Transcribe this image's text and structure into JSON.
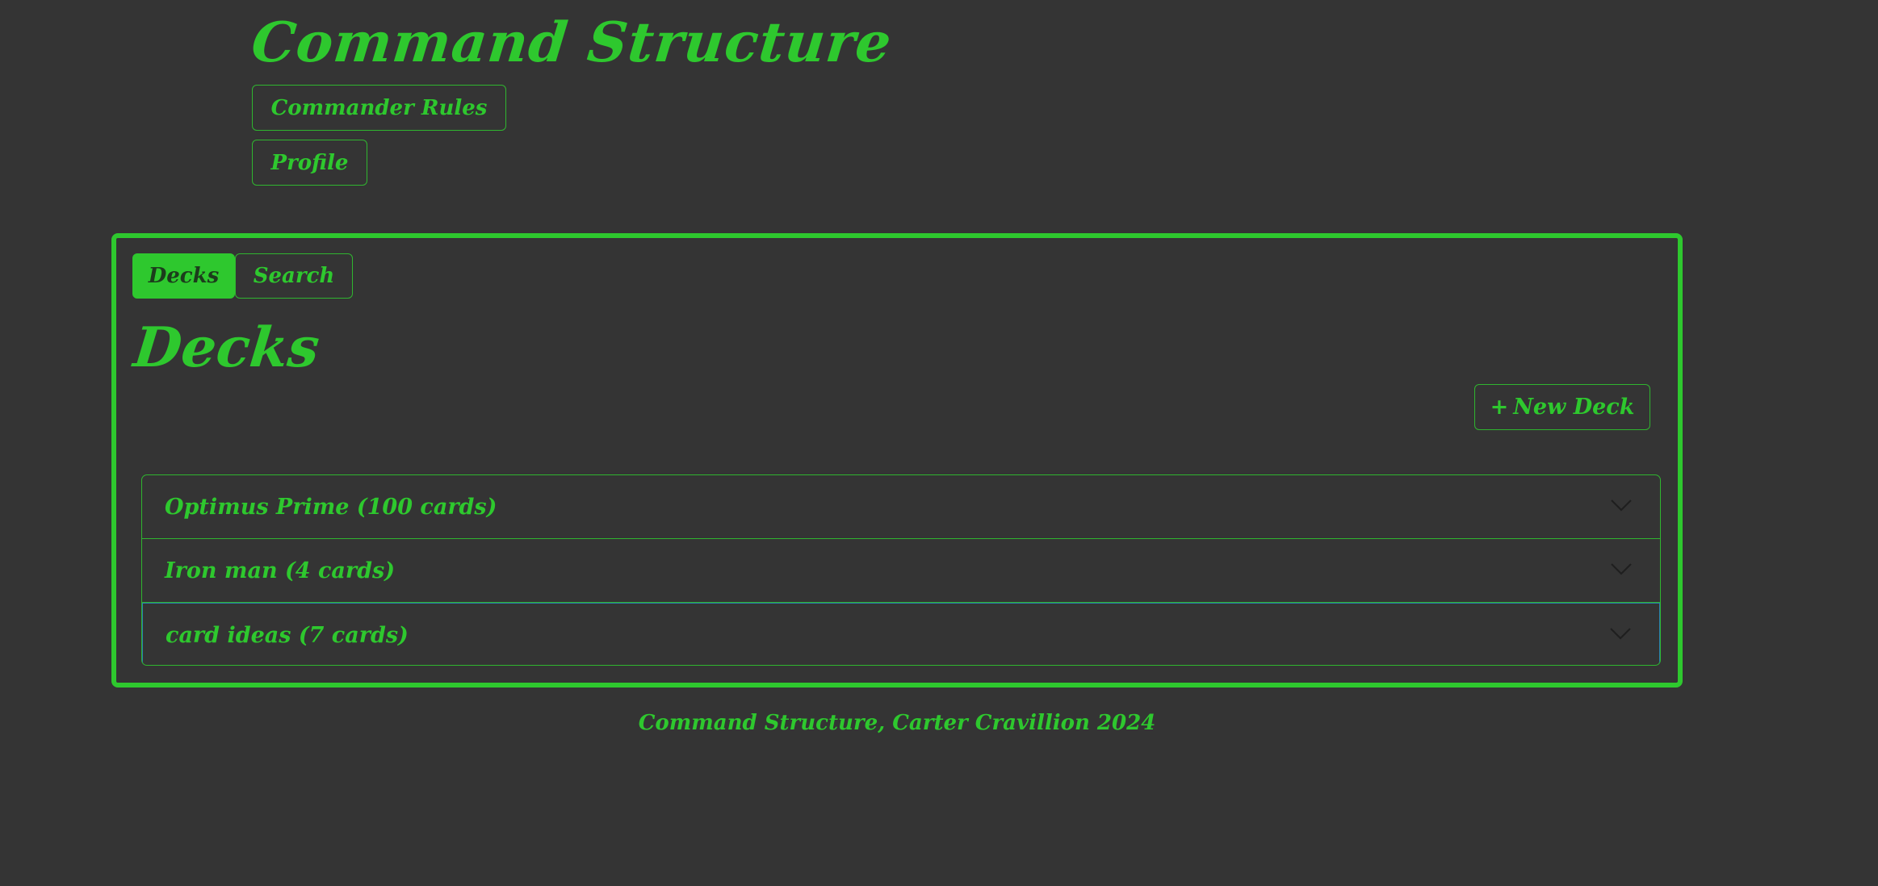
{
  "header": {
    "title": "Command Structure",
    "nav": {
      "rules_label": "Commander Rules",
      "profile_label": "Profile"
    }
  },
  "panel": {
    "tabs": [
      {
        "label": "Decks",
        "active": true
      },
      {
        "label": "Search",
        "active": false
      }
    ],
    "title": "Decks",
    "new_deck_icon": "+",
    "new_deck_label": "New Deck",
    "decks": [
      {
        "label": "Optimus Prime (100 cards)",
        "icon": "chevron-down-icon"
      },
      {
        "label": "Iron man (4 cards)",
        "icon": "chevron-down-icon"
      },
      {
        "label": "card ideas (7 cards)",
        "icon": "chevron-down-icon"
      }
    ]
  },
  "footer": {
    "text": "Command Structure, Carter Cravillion 2024"
  },
  "colors": {
    "background": "#343434",
    "accent": "#2ec82e",
    "focus_ring": "#2a7fb0"
  }
}
